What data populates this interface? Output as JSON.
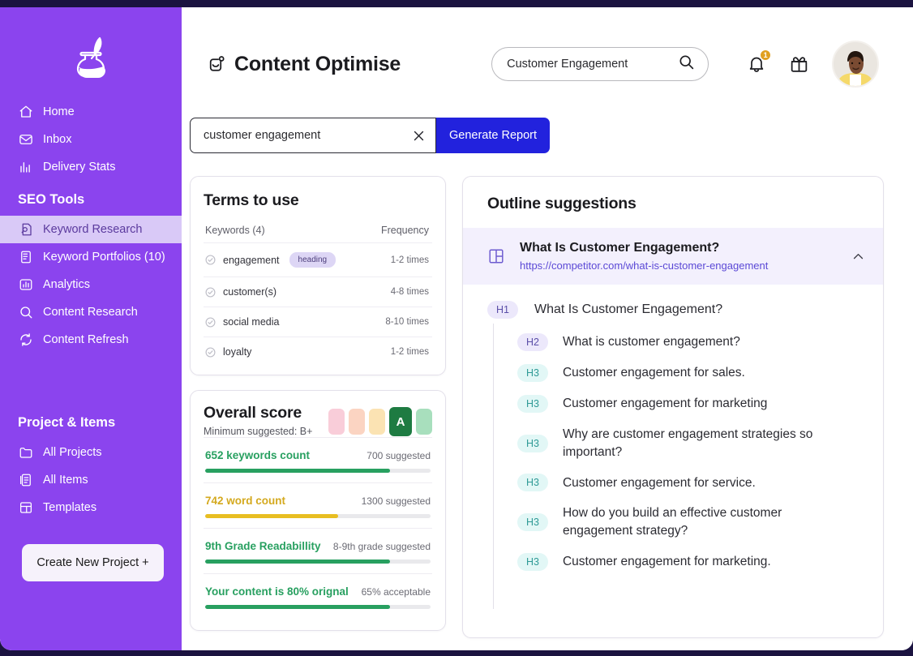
{
  "sidebar": {
    "logo_icon": "ink-bottle-quill-icon",
    "nav": [
      {
        "label": "Home",
        "icon": "home-icon"
      },
      {
        "label": "Inbox",
        "icon": "inbox-icon"
      },
      {
        "label": "Delivery Stats",
        "icon": "bar-chart-icon"
      }
    ],
    "seo_section_title": "SEO Tools",
    "seo_items": [
      {
        "label": "Keyword Research",
        "icon": "keyword-research-icon",
        "active": true
      },
      {
        "label": "Keyword Portfolios (10)",
        "icon": "portfolio-icon",
        "active": false
      },
      {
        "label": "Analytics",
        "icon": "analytics-icon",
        "active": false
      },
      {
        "label": "Content  Research",
        "icon": "content-research-icon",
        "active": false
      },
      {
        "label": "Content  Refresh",
        "icon": "refresh-icon",
        "active": false
      }
    ],
    "project_section_title": "Project & Items",
    "project_items": [
      {
        "label": "All Projects",
        "icon": "folder-icon"
      },
      {
        "label": "All Items",
        "icon": "items-icon"
      },
      {
        "label": "Templates",
        "icon": "templates-icon"
      }
    ],
    "create_button": "Create New Project +",
    "bg_color": "#8B44EE",
    "active_bg_color": "#d9c9f7"
  },
  "header": {
    "title": "Content Optimise",
    "title_icon": "content-optimise-icon",
    "search": {
      "value": "Customer Engagement",
      "placeholder": "Search",
      "icon": "search-icon"
    },
    "notifications": {
      "icon": "bell-icon",
      "count": "1",
      "badge_color": "#E0A020"
    },
    "gift": {
      "icon": "gift-icon"
    },
    "avatar": {
      "name": "avatar"
    }
  },
  "keyword_bar": {
    "value": "customer engagement",
    "placeholder": "Enter keyword",
    "clear_icon": "close-icon",
    "generate_label": "Generate Report",
    "generate_color": "#2222DD"
  },
  "terms_card": {
    "title": "Terms to use",
    "col_keywords": "Keywords (4)",
    "col_frequency": "Frequency",
    "rows": [
      {
        "name": "engagement",
        "tag": "heading",
        "frequency": "1-2 times",
        "icon": "check-circle-icon"
      },
      {
        "name": "customer(s)",
        "tag": "",
        "frequency": "4-8 times",
        "icon": "check-circle-icon"
      },
      {
        "name": "social media",
        "tag": "",
        "frequency": "8-10 times",
        "icon": "check-circle-icon"
      },
      {
        "name": "loyalty",
        "tag": "",
        "frequency": "1-2 times",
        "icon": "check-circle-icon"
      }
    ]
  },
  "score_card": {
    "title": "Overall score",
    "subtitle": "Minimum suggested: B+",
    "grades": [
      {
        "label": "",
        "color": "#f9cdd9",
        "active": false
      },
      {
        "label": "",
        "color": "#fbd4c2",
        "active": false
      },
      {
        "label": "",
        "color": "#fbe3b3",
        "active": false
      },
      {
        "label": "A",
        "color": "#1e7b42",
        "active": true
      },
      {
        "label": "",
        "color": "#a8dfbd",
        "active": false
      }
    ],
    "metrics": [
      {
        "label": "652 keywords count",
        "suggested": "700 suggested",
        "percent": 82,
        "color": "#28a060"
      },
      {
        "label": "742 word count",
        "suggested": "1300 suggested",
        "percent": 59,
        "color": "#E8BE22"
      },
      {
        "label": "9th Grade Readabillity",
        "suggested": "8-9th grade suggested",
        "percent": 82,
        "color": "#28a060"
      },
      {
        "label": "Your content is 80% orignal",
        "suggested": "65% acceptable",
        "percent": 82,
        "color": "#28a060"
      }
    ]
  },
  "outline_card": {
    "title": "Outline suggestions",
    "competitor": {
      "icon": "layout-grid-icon",
      "title": "What Is Customer Engagement?",
      "url": "https://competitor.com/what-is-customer-engagement",
      "collapse_icon": "chevron-up-icon"
    },
    "items": [
      {
        "level": "H1",
        "text": "What Is Customer Engagement?"
      },
      {
        "level": "H2",
        "text": "What is customer engagement?"
      },
      {
        "level": "H3",
        "text": "Customer engagement for sales."
      },
      {
        "level": "H3",
        "text": "Customer engagement for marketing"
      },
      {
        "level": "H3",
        "text": "Why are customer engagement strategies so important?"
      },
      {
        "level": "H3",
        "text": "Customer engagement for service."
      },
      {
        "level": "H3",
        "text": "How do you build an effective customer engagement strategy?"
      },
      {
        "level": "H3",
        "text": "Customer engagement for marketing."
      }
    ]
  }
}
